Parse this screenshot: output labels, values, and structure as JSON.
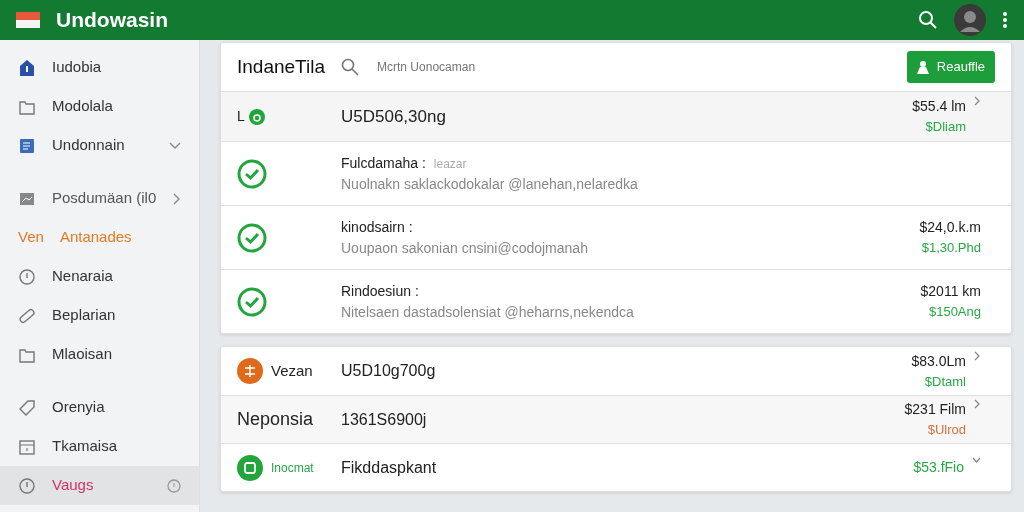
{
  "app_bar": {
    "title": "Undowasin"
  },
  "sidebar": {
    "items": [
      {
        "label": "Iudobia",
        "kind": "link",
        "selected": false
      },
      {
        "label": "Modolala",
        "kind": "link",
        "selected": false
      },
      {
        "label": "Undonnain",
        "kind": "link",
        "selected": false
      },
      {
        "label": "Posdumäan (il0",
        "kind": "muted",
        "selected": false
      },
      {
        "label": "Antanades",
        "prefix": "Ven",
        "kind": "accent",
        "selected": false
      },
      {
        "label": "Nenaraia",
        "kind": "link",
        "selected": false
      },
      {
        "label": "Beplarian",
        "kind": "link",
        "selected": false
      },
      {
        "label": "Mlaoisan",
        "kind": "link",
        "selected": false
      },
      {
        "label": "Orenyia",
        "kind": "link",
        "selected": false
      },
      {
        "label": "Tkamaisa",
        "kind": "link",
        "selected": false
      },
      {
        "label": "Vaugs",
        "kind": "link",
        "selected": true
      }
    ]
  },
  "panel": {
    "title": "IndaneTila",
    "search": {
      "placeholder": "Mcrtn Uonocaman"
    },
    "button": "Reauffle",
    "rows": [
      {
        "kind": "summary",
        "lead": "L",
        "main": "U5D506,30ng",
        "amount": "$55.4 lm",
        "sub": "$Dliam",
        "color": "#28a745"
      },
      {
        "kind": "detail",
        "title": "Fulcdamaha :",
        "note": "leazar",
        "subtitle": "Nuolnakn saklackodokalar @lanehan,nelaredka"
      },
      {
        "kind": "detail",
        "title": "kinodsairn :",
        "subtitle": "Uoupaon sakonian cnsini@codojmanah",
        "amount": "$24,0.k.m",
        "sub": "$1,30.Phd",
        "color": "#28a745"
      },
      {
        "kind": "detail",
        "title": "Rindoesiun :",
        "subtitle": "Nitelsaen dastadsolensiat @heharns,nekendca",
        "amount": "$2011 km",
        "sub": "$150Ang",
        "color": "#28a745"
      }
    ]
  },
  "accounts": {
    "rows": [
      {
        "kind": "orange",
        "label": "Vezan",
        "main": "U5D10g700g",
        "amount": "$83.0Lm",
        "sub": "$Dtaml",
        "color": "#28a745"
      },
      {
        "kind": "plain",
        "label": "Neponsia",
        "main": "1361S6900j",
        "amount": "$231 Film",
        "sub": "$Ulrod",
        "color": "#d9703a"
      },
      {
        "kind": "green",
        "label": "Inocmat",
        "main": "Fikddaspkant",
        "amount": "$53.fFio",
        "color": "#28a745"
      }
    ]
  }
}
